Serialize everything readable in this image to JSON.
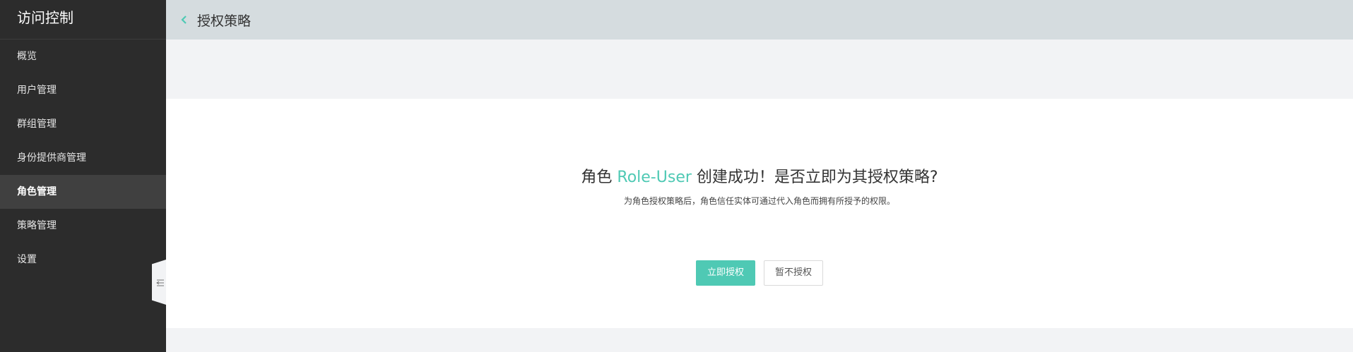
{
  "sidebar": {
    "title": "访问控制",
    "items": [
      {
        "label": "概览",
        "active": false
      },
      {
        "label": "用户管理",
        "active": false
      },
      {
        "label": "群组管理",
        "active": false
      },
      {
        "label": "身份提供商管理",
        "active": false
      },
      {
        "label": "角色管理",
        "active": true
      },
      {
        "label": "策略管理",
        "active": false
      },
      {
        "label": "设置",
        "active": false
      }
    ]
  },
  "header": {
    "title": "授权策略"
  },
  "main": {
    "headline_prefix": "角色",
    "role_name": "Role-User",
    "headline_suffix": "创建成功！是否立即为其授权策略?",
    "subtext": "为角色授权策略后，角色信任实体可通过代入角色而拥有所授予的权限。",
    "primary_button": "立即授权",
    "secondary_button": "暂不授权"
  },
  "colors": {
    "accent": "#4fc9b4",
    "sidebar_bg": "#2c2c2c",
    "header_bg": "#d5dcdf"
  }
}
